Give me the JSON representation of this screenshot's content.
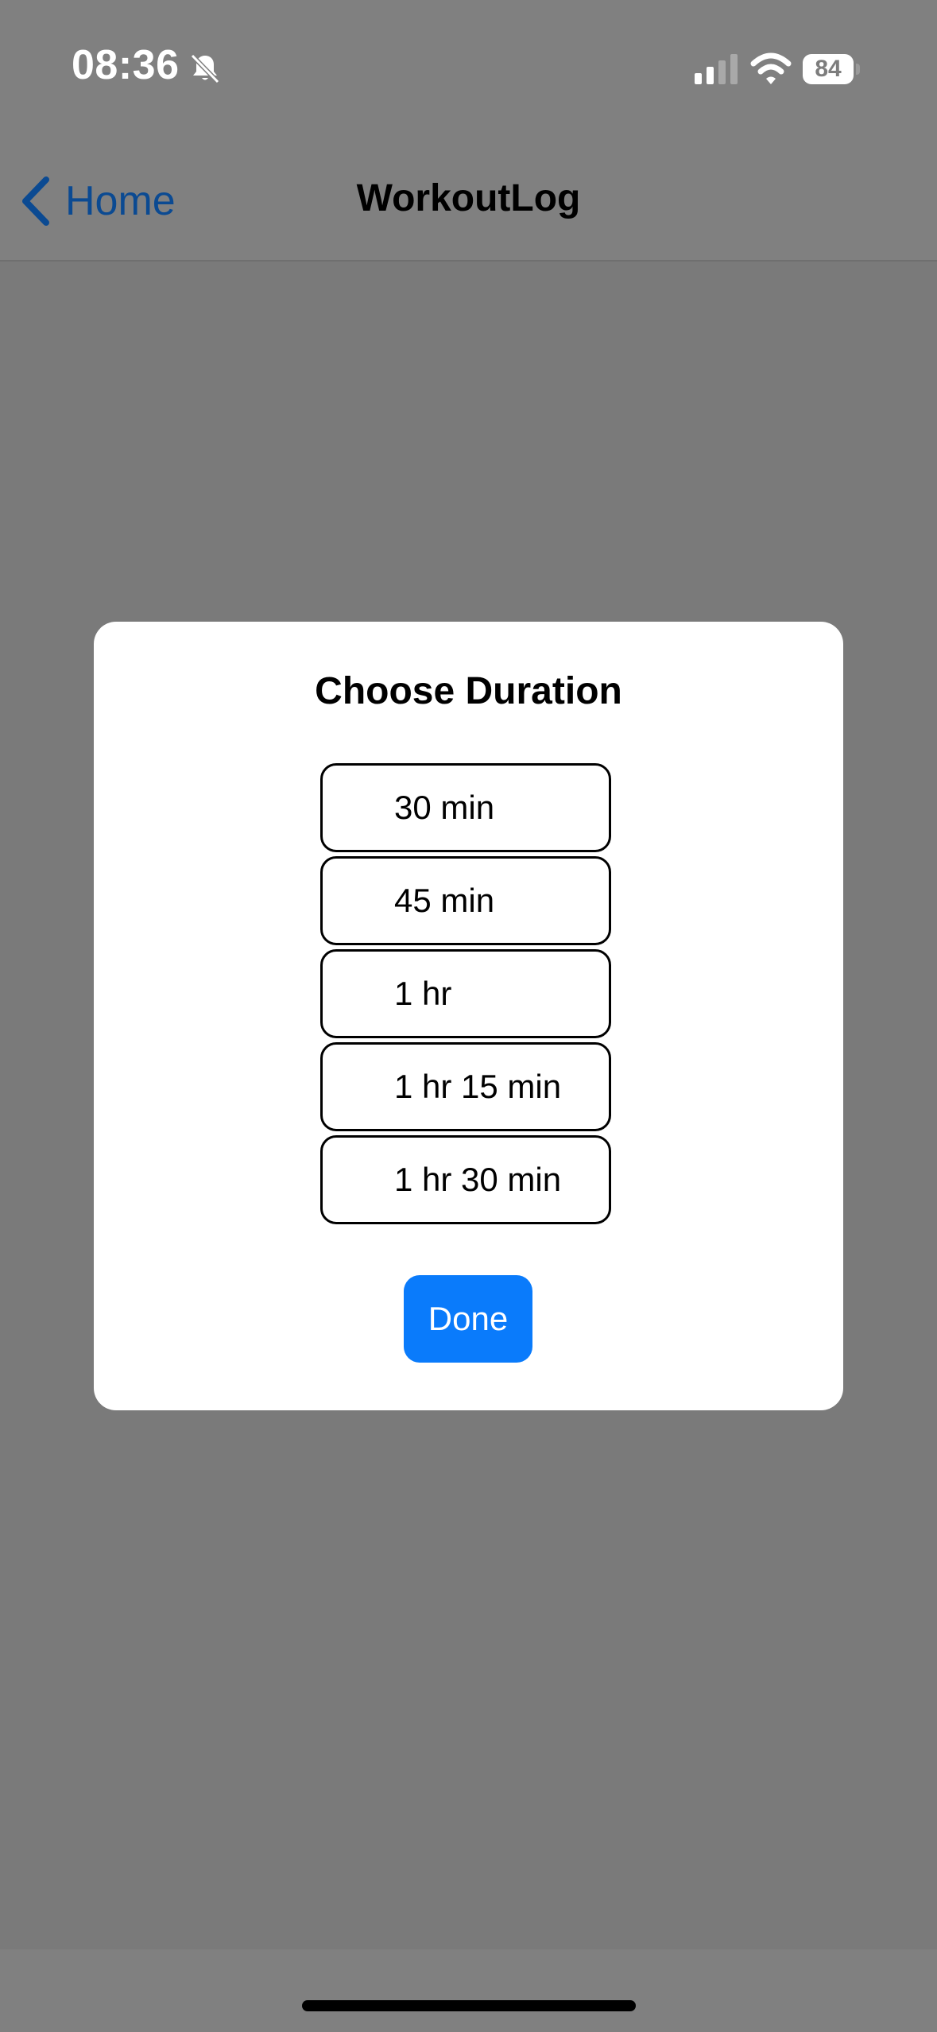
{
  "status_bar": {
    "time": "08:36",
    "battery_level": "84",
    "icons": [
      "bell-slash-icon",
      "cellular-signal-icon",
      "wifi-icon",
      "battery-icon"
    ]
  },
  "nav": {
    "back_label": "Home",
    "title": "WorkoutLog"
  },
  "modal": {
    "title": "Choose Duration",
    "options": [
      {
        "label": "30 min"
      },
      {
        "label": "45 min"
      },
      {
        "label": "1 hr"
      },
      {
        "label": "1 hr 15 min"
      },
      {
        "label": "1 hr 30 min"
      }
    ],
    "done_label": "Done"
  },
  "colors": {
    "accent": "#0a7bfb",
    "back_link": "#0b4a92",
    "overlay": "#7a7a7a"
  }
}
